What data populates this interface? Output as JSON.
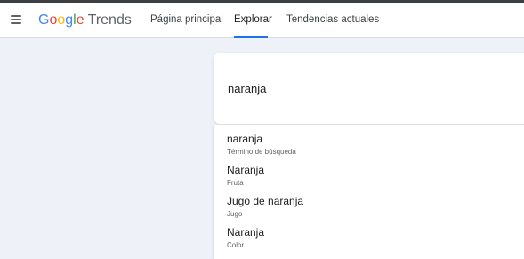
{
  "header": {
    "logo": {
      "google": [
        "G",
        "o",
        "o",
        "g",
        "l",
        "e"
      ],
      "product": "Trends"
    },
    "nav": [
      {
        "label": "Página principal"
      },
      {
        "label": "Explorar",
        "active": true
      },
      {
        "label": "Tendencias actuales"
      }
    ]
  },
  "search": {
    "value": "naranja"
  },
  "suggestions": [
    {
      "title": "naranja",
      "subtitle": "Término de búsqueda"
    },
    {
      "title": "Naranja",
      "subtitle": "Fruta"
    },
    {
      "title": "Jugo de naranja",
      "subtitle": "Jugo"
    },
    {
      "title": "Naranja",
      "subtitle": "Color"
    }
  ],
  "colors": {
    "accent": "#1a73e8",
    "background": "#eef2f8",
    "google_blue": "#4285f4",
    "google_red": "#ea4335",
    "google_yellow": "#fbbc05",
    "google_green": "#34a853"
  },
  "icons": {
    "menu": "hamburger-menu-icon"
  }
}
